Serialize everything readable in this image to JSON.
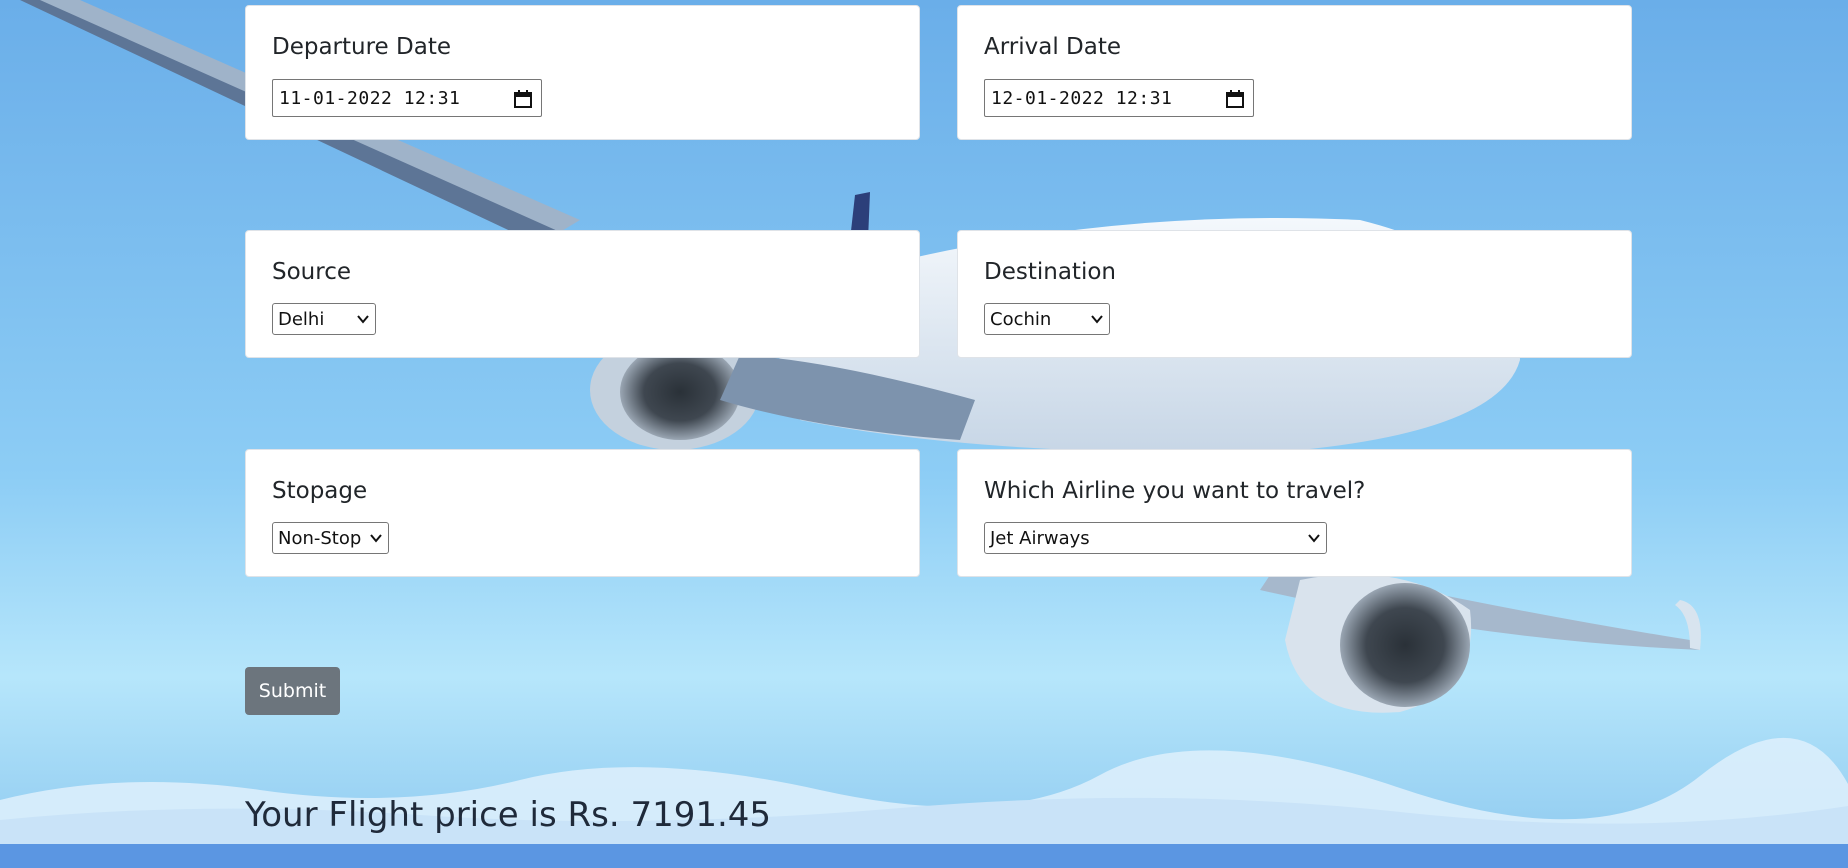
{
  "form": {
    "departure": {
      "label": "Departure Date",
      "value": "11-01-2022 12:31"
    },
    "arrival": {
      "label": "Arrival Date",
      "value": "12-01-2022 12:31"
    },
    "source": {
      "label": "Source",
      "value": "Delhi"
    },
    "destination": {
      "label": "Destination",
      "value": "Cochin"
    },
    "stopage": {
      "label": "Stopage",
      "value": "Non-Stop"
    },
    "airline": {
      "label": "Which Airline you want to travel?",
      "value": "Jet Airways"
    },
    "submit_label": "Submit"
  },
  "result": {
    "text": "Your Flight price is Rs. 7191.45"
  },
  "colors": {
    "sky": "#7ec0f0",
    "card": "#ffffff",
    "button": "#6c757d",
    "strip": "#5b96e2"
  },
  "icons": {
    "date": "calendar-icon",
    "select": "chevron-down-icon"
  }
}
